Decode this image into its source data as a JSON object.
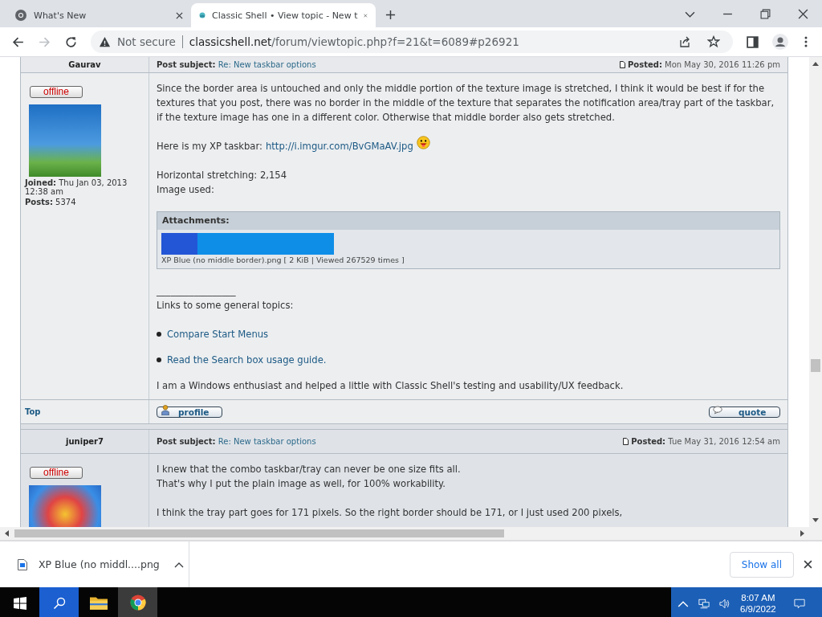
{
  "tabs": [
    {
      "title": "What's New",
      "selected": false
    },
    {
      "title": "Classic Shell • View topic - New t",
      "selected": true
    }
  ],
  "toolbar": {
    "back_enabled": true,
    "forward_enabled": false,
    "security": "Not secure",
    "url_host": "classicshell.net",
    "url_path": "/forum/viewtopic.php?f=21&t=6089#p26921"
  },
  "posts": [
    {
      "author": "Gaurav",
      "status": "offline",
      "joined_label": "Joined:",
      "joined": "Thu Jan 03, 2013 12:38 am",
      "posts_label": "Posts:",
      "posts": "5374",
      "subject_label": "Post subject:",
      "subject": "Re: New taskbar options",
      "posted_label": "Posted:",
      "posted": "Mon May 30, 2016 11:26 pm",
      "body": [
        {
          "kind": "paragraph",
          "text": "Since the border area is untouched and only the middle portion of the texture image is stretched, I think it would be best if for the textures that you post, there was no border in the middle of the texture that separates the notification area/tray part of the taskbar, if the texture image has one in a different color. Otherwise that middle border also gets stretched."
        },
        {
          "kind": "link_line",
          "prefix": "Here is my XP taskbar:",
          "link": "http://i.imgur.com/BvGMaAV.jpg",
          "emoji": true
        },
        {
          "kind": "lines",
          "lines": [
            "Horizontal stretching: 2,154",
            "Image used:"
          ]
        },
        {
          "kind": "attachment",
          "heading": "Attachments:",
          "caption": "XP Blue (no middle border).png [ 2 KiB | Viewed 267529 times ]"
        },
        {
          "kind": "lines",
          "lines": [
            "_________________",
            "Links to some general topics:"
          ]
        },
        {
          "kind": "bullet",
          "link": "Compare Start Menus"
        },
        {
          "kind": "bullet",
          "link": "Read the Search box usage guide."
        },
        {
          "kind": "paragraph",
          "text": "I am a Windows enthusiast and helped a little with Classic Shell's testing and usability/UX feedback."
        }
      ],
      "footer": {
        "top": "Top",
        "profile": "profile",
        "quote": "quote"
      }
    },
    {
      "author": "juniper7",
      "status": "offline",
      "subject_label": "Post subject:",
      "subject": "Re: New taskbar options",
      "posted_label": "Posted:",
      "posted": "Tue May 31, 2016 12:54 am",
      "body": [
        {
          "kind": "lines",
          "lines": [
            "I knew that the combo taskbar/tray can never be one size fits all.",
            "That's why I put the plain image as well, for 100% workability."
          ]
        },
        {
          "kind": "paragraph",
          "text": "I think the tray part goes for 171 pixels. So the right border should be 171, or I just used 200 pixels,"
        }
      ]
    }
  ],
  "download": {
    "file": "XP Blue (no middl....png",
    "show_all": "Show all"
  },
  "taskbar": {
    "time": "8:07 AM",
    "date": "6/9/2022"
  }
}
